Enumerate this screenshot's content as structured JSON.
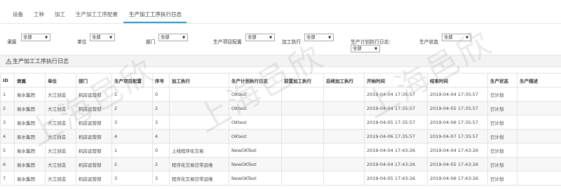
{
  "tabs": [
    {
      "label": "设备"
    },
    {
      "label": "工种"
    },
    {
      "label": "加工"
    },
    {
      "label": "生产加工工序配置"
    },
    {
      "label": "生产加工工序执行日志"
    }
  ],
  "filters": {
    "owner": {
      "label": "隶属",
      "value": "全部"
    },
    "unit": {
      "label": "单位",
      "value": "全部"
    },
    "dept": {
      "label": "部门",
      "value": "全部"
    },
    "project": {
      "label": "生产项目配置",
      "value": "全部"
    },
    "exec": {
      "label": "加工执行",
      "value": "全部"
    },
    "plan_log": {
      "label": "生产计划执行日志:",
      "value": "全部"
    },
    "status": {
      "label": "生产状态",
      "value": "全部"
    }
  },
  "section": {
    "title": "生产加工工序执行日志"
  },
  "table": {
    "headers": [
      "ID",
      "隶属",
      "单位",
      "部门",
      "生产项目配置",
      "序号",
      "加工执行",
      "生产计划执行日志",
      "前置加工执行",
      "后续加工执行",
      "开始时间",
      "结束时间",
      "生产状态",
      "生产描述"
    ],
    "rows": [
      [
        "1",
        "易水集团",
        "大江创造",
        "机房运营部",
        "1",
        "0",
        "",
        "OKtest",
        "",
        "",
        "2019-04-04 17:35:57",
        "2019-04-04 17:35:57",
        "已计划",
        ""
      ],
      [
        "2",
        "易水集团",
        "大江创造",
        "机房运营部",
        "2",
        "2",
        "",
        "OKtest",
        "",
        "",
        "2019-04-04 17:35:57",
        "2019-04-05 17:35:57",
        "已计划",
        ""
      ],
      [
        "3",
        "易水集团",
        "大江创造",
        "机房运营部",
        "3",
        "3",
        "",
        "OKtest",
        "",
        "",
        "2019-04-05 17:35:57",
        "2019-04-06 17:35:57",
        "已计划",
        ""
      ],
      [
        "4",
        "易水集团",
        "大江创造",
        "机房运营部",
        "4",
        "4",
        "",
        "OKtest",
        "",
        "",
        "2019-04-06 17:35:57",
        "2019-04-07 17:35:57",
        "已计划",
        ""
      ],
      [
        "5",
        "易水集团",
        "大江创造",
        "机房运营部",
        "1",
        "0",
        "上线程序化交易",
        "NewOKTest",
        "",
        "",
        "2019-04-04 17:43:26",
        "2019-04-04 17:43:26",
        "已计划",
        ""
      ],
      [
        "6",
        "易水集团",
        "大江创造",
        "机房运营部",
        "2",
        "2",
        "程序化交易日常运维",
        "NewOKTest",
        "",
        "",
        "2019-04-04 17:43:26",
        "2019-04-05 17:43:26",
        "已计划",
        ""
      ],
      [
        "7",
        "易水集团",
        "大江创造",
        "机房运营部",
        "3",
        "3",
        "程序化交易日常运维",
        "NewOKTest",
        "",
        "",
        "2019-04-05 17:43:26",
        "2019-04-06 17:43:26",
        "已计划",
        ""
      ]
    ]
  },
  "watermark": {
    "text": "上海邑欣"
  }
}
